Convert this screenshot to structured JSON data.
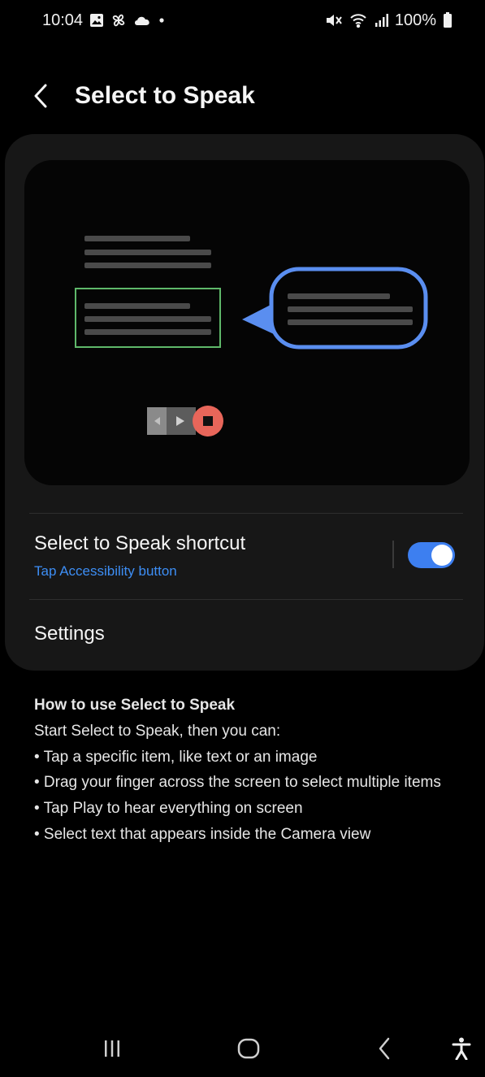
{
  "status_bar": {
    "time": "10:04",
    "left_icons": [
      "gallery-icon",
      "pinwheel-icon",
      "cloud-icon",
      "dot-icon"
    ],
    "right_icons": [
      "mute-icon",
      "wifi-icon",
      "signal-icon",
      "battery-icon"
    ],
    "battery": "100%"
  },
  "header": {
    "title": "Select to Speak"
  },
  "colors": {
    "accent": "#3d8ef5",
    "toggle_on": "#3d7ff0",
    "selection_box": "#5fb86a",
    "speech_bubble": "#5a8ef0",
    "stop_button": "#e8665a"
  },
  "shortcut": {
    "title": "Select to Speak shortcut",
    "subtitle": "Tap Accessibility button",
    "enabled": true
  },
  "settings": {
    "label": "Settings"
  },
  "help": {
    "title": "How to use Select to Speak",
    "intro": "Start Select to Speak, then you can:",
    "items": [
      "• Tap a specific item, like text or an image",
      "• Drag your finger across the screen to select multiple items",
      "• Tap Play to hear everything on screen",
      "• Select text that appears inside the Camera view"
    ]
  },
  "nav_bar": {
    "icons": [
      "recents-icon",
      "home-icon",
      "back-icon",
      "accessibility-icon"
    ]
  }
}
